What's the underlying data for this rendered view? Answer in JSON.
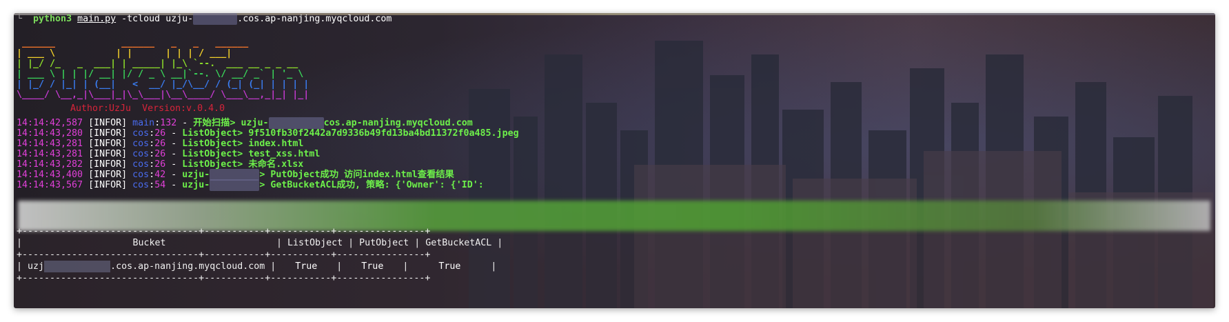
{
  "command": {
    "prompt_glyph": "└",
    "program": "python3",
    "file": "main.py",
    "args_prefix": " -tcloud uzju-",
    "redacted": "xxxxxxxx",
    "args_suffix": ".cos.ap-nanjing.myqcloud.com"
  },
  "banner": {
    "lines": [
      " ______            ______   _   _   ______",
      "| ___ \\           | |      | | | / ___|",
      "| |_/ /_   _  ___| | _____| |_\\ `--.  ___ __ _ _ __",
      "| ___ \\ | | |/ __| |/ / _ \\ __|`--. \\/ __/ _` | '_ \\",
      "| |_/ / |_| | (__|   <  __/ |_/\\__/ / (_| (_| | | | |",
      "\\____/ \\__,_|\\___|_|\\_\\___|\\__\\____/ \\___\\__,_|_| |_|"
    ],
    "author": "Author:UzJu  Version:v.0.4.0"
  },
  "logs": [
    {
      "time": "14:14:42,587",
      "level": "[INFOR]",
      "module": "main",
      "sep": ":",
      "lineno": "132",
      "dash": " - ",
      "msg_prefix": "开始扫描> uzju-",
      "redacted": "xxxxxxxxxx",
      "msg_suffix": "cos.ap-nanjing.myqcloud.com"
    },
    {
      "time": "14:14:43,280",
      "level": "[INFOR]",
      "module": "cos",
      "sep": ":",
      "lineno": "26",
      "dash": " - ",
      "msg_prefix": "ListObject> 9f510fb30f2442a7d9336b49fd13ba4bd11372f0a485.jpeg",
      "redacted": "",
      "msg_suffix": ""
    },
    {
      "time": "14:14:43,281",
      "level": "[INFOR]",
      "module": "cos",
      "sep": ":",
      "lineno": "26",
      "dash": " - ",
      "msg_prefix": "ListObject> index.html",
      "redacted": "",
      "msg_suffix": ""
    },
    {
      "time": "14:14:43,281",
      "level": "[INFOR]",
      "module": "cos",
      "sep": ":",
      "lineno": "26",
      "dash": " - ",
      "msg_prefix": "ListObject> test_xss.html",
      "redacted": "",
      "msg_suffix": ""
    },
    {
      "time": "14:14:43,282",
      "level": "[INFOR]",
      "module": "cos",
      "sep": ":",
      "lineno": "26",
      "dash": " - ",
      "msg_prefix": "ListObject> 未命名.xlsx",
      "redacted": "",
      "msg_suffix": ""
    },
    {
      "time": "14:14:43,400",
      "level": "[INFOR]",
      "module": "cos",
      "sep": ":",
      "lineno": "42",
      "dash": " - ",
      "msg_prefix": "uzju-",
      "redacted": "xxxxxxxxx",
      "msg_suffix": "> PutObject成功 访问index.html查看结果"
    },
    {
      "time": "14:14:43,567",
      "level": "[INFOR]",
      "module": "cos",
      "sep": ":",
      "lineno": "54",
      "dash": " - ",
      "msg_prefix": "uzju-",
      "redacted": "xxxxxxxxx",
      "msg_suffix": "> GetBucketACL成功, 策略: {'Owner': {'ID':"
    }
  ],
  "table": {
    "border": "+--------------------------------+-----------+-----------+----------------+",
    "headers": [
      "Bucket",
      "ListObject",
      "PutObject",
      "GetBucketACL"
    ],
    "rows": [
      {
        "bucket_prefix": "uzj",
        "redacted": "xxxxxxxxxxxx",
        "bucket_suffix": ".cos.ap-nanjing.myqcloud.com",
        "list": "True",
        "put": "True",
        "acl": "True"
      }
    ]
  },
  "colors": {
    "timestamp": "#e040d8",
    "module": "#4a6cf0",
    "message": "#6df04a",
    "author": "#d8243a",
    "command": "#7cdc5c"
  }
}
